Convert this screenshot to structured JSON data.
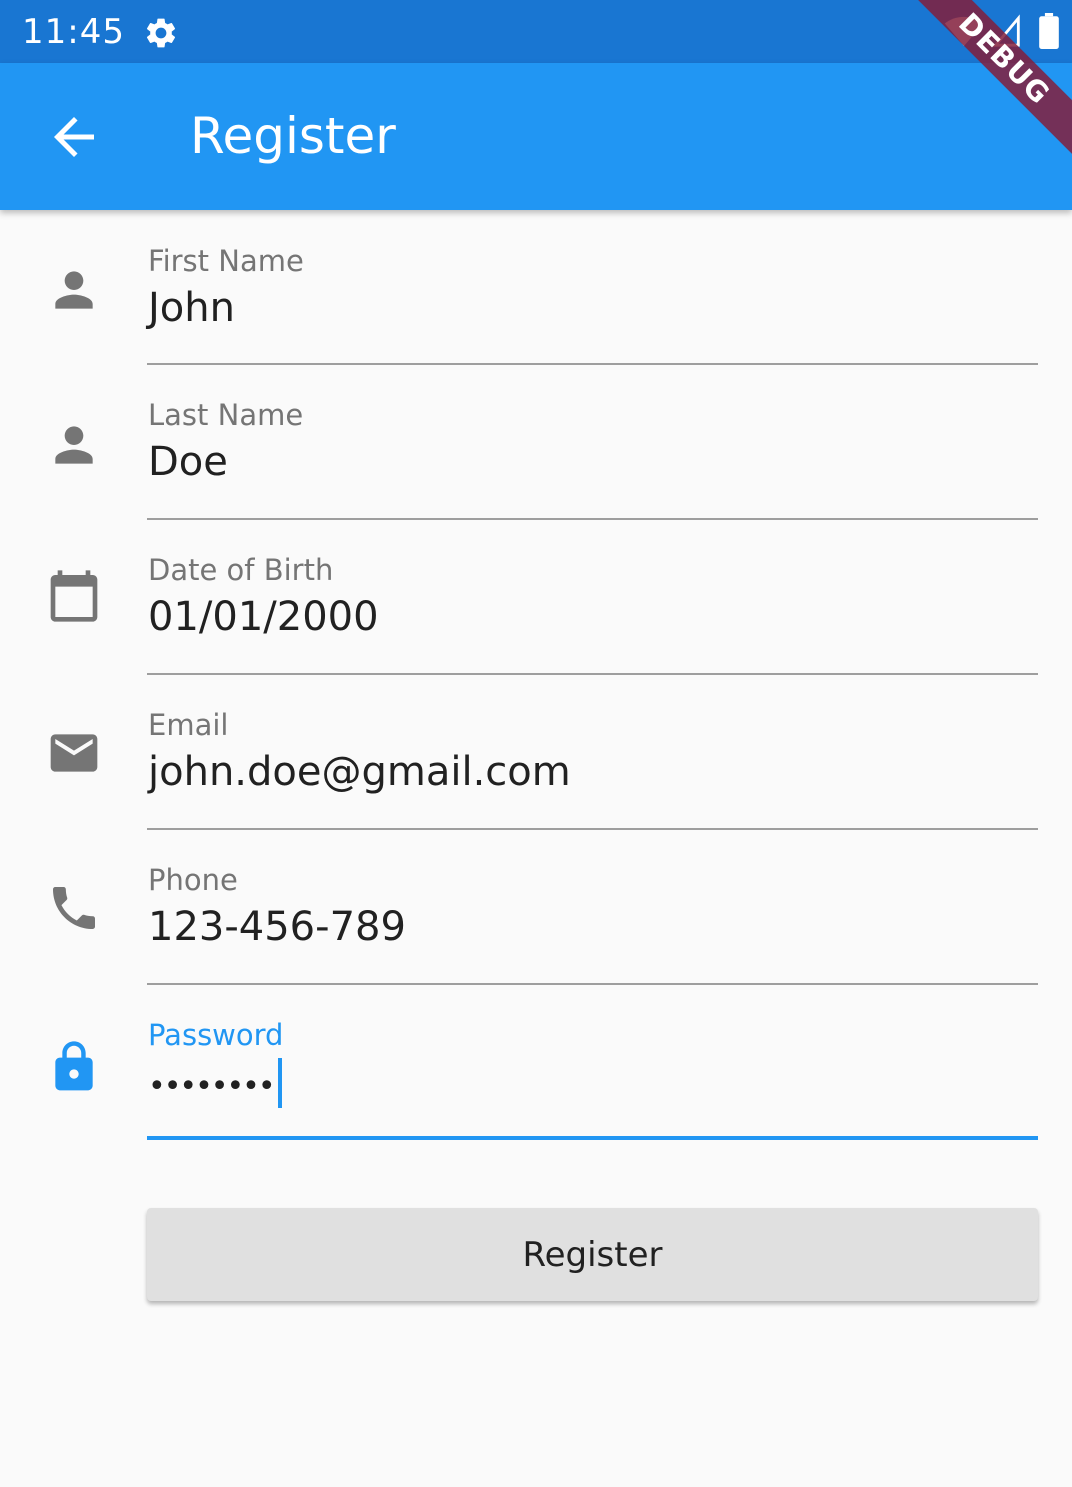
{
  "status_bar": {
    "time": "11:45"
  },
  "debug_banner": "DEBUG",
  "app_bar": {
    "title": "Register"
  },
  "fields": [
    {
      "label": "First Name",
      "value": "John",
      "icon": "person-icon"
    },
    {
      "label": "Last Name",
      "value": "Doe",
      "icon": "person-icon"
    },
    {
      "label": "Date of Birth",
      "value": "01/01/2000",
      "icon": "calendar-icon"
    },
    {
      "label": "Email",
      "value": "john.doe@gmail.com",
      "icon": "email-icon"
    },
    {
      "label": "Phone",
      "value": "123-456-789",
      "icon": "phone-icon"
    },
    {
      "label": "Password",
      "value": "••••••••",
      "icon": "lock-icon",
      "focused": true
    }
  ],
  "register_button": {
    "label": "Register"
  },
  "colors": {
    "status_bar": "#1976d2",
    "app_bar": "#2196f3",
    "accent": "#2196f3",
    "icon_inactive": "#757575"
  }
}
